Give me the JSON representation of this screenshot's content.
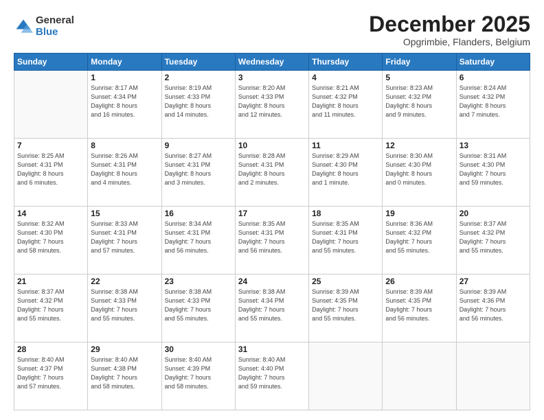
{
  "logo": {
    "general": "General",
    "blue": "Blue"
  },
  "title": "December 2025",
  "subtitle": "Opgrimbie, Flanders, Belgium",
  "days_header": [
    "Sunday",
    "Monday",
    "Tuesday",
    "Wednesday",
    "Thursday",
    "Friday",
    "Saturday"
  ],
  "weeks": [
    [
      {
        "num": "",
        "info": "",
        "empty": true
      },
      {
        "num": "1",
        "info": "Sunrise: 8:17 AM\nSunset: 4:34 PM\nDaylight: 8 hours\nand 16 minutes."
      },
      {
        "num": "2",
        "info": "Sunrise: 8:19 AM\nSunset: 4:33 PM\nDaylight: 8 hours\nand 14 minutes."
      },
      {
        "num": "3",
        "info": "Sunrise: 8:20 AM\nSunset: 4:33 PM\nDaylight: 8 hours\nand 12 minutes."
      },
      {
        "num": "4",
        "info": "Sunrise: 8:21 AM\nSunset: 4:32 PM\nDaylight: 8 hours\nand 11 minutes."
      },
      {
        "num": "5",
        "info": "Sunrise: 8:23 AM\nSunset: 4:32 PM\nDaylight: 8 hours\nand 9 minutes."
      },
      {
        "num": "6",
        "info": "Sunrise: 8:24 AM\nSunset: 4:32 PM\nDaylight: 8 hours\nand 7 minutes."
      }
    ],
    [
      {
        "num": "7",
        "info": "Sunrise: 8:25 AM\nSunset: 4:31 PM\nDaylight: 8 hours\nand 6 minutes."
      },
      {
        "num": "8",
        "info": "Sunrise: 8:26 AM\nSunset: 4:31 PM\nDaylight: 8 hours\nand 4 minutes."
      },
      {
        "num": "9",
        "info": "Sunrise: 8:27 AM\nSunset: 4:31 PM\nDaylight: 8 hours\nand 3 minutes."
      },
      {
        "num": "10",
        "info": "Sunrise: 8:28 AM\nSunset: 4:31 PM\nDaylight: 8 hours\nand 2 minutes."
      },
      {
        "num": "11",
        "info": "Sunrise: 8:29 AM\nSunset: 4:30 PM\nDaylight: 8 hours\nand 1 minute."
      },
      {
        "num": "12",
        "info": "Sunrise: 8:30 AM\nSunset: 4:30 PM\nDaylight: 8 hours\nand 0 minutes."
      },
      {
        "num": "13",
        "info": "Sunrise: 8:31 AM\nSunset: 4:30 PM\nDaylight: 7 hours\nand 59 minutes."
      }
    ],
    [
      {
        "num": "14",
        "info": "Sunrise: 8:32 AM\nSunset: 4:30 PM\nDaylight: 7 hours\nand 58 minutes."
      },
      {
        "num": "15",
        "info": "Sunrise: 8:33 AM\nSunset: 4:31 PM\nDaylight: 7 hours\nand 57 minutes."
      },
      {
        "num": "16",
        "info": "Sunrise: 8:34 AM\nSunset: 4:31 PM\nDaylight: 7 hours\nand 56 minutes."
      },
      {
        "num": "17",
        "info": "Sunrise: 8:35 AM\nSunset: 4:31 PM\nDaylight: 7 hours\nand 56 minutes."
      },
      {
        "num": "18",
        "info": "Sunrise: 8:35 AM\nSunset: 4:31 PM\nDaylight: 7 hours\nand 55 minutes."
      },
      {
        "num": "19",
        "info": "Sunrise: 8:36 AM\nSunset: 4:32 PM\nDaylight: 7 hours\nand 55 minutes."
      },
      {
        "num": "20",
        "info": "Sunrise: 8:37 AM\nSunset: 4:32 PM\nDaylight: 7 hours\nand 55 minutes."
      }
    ],
    [
      {
        "num": "21",
        "info": "Sunrise: 8:37 AM\nSunset: 4:32 PM\nDaylight: 7 hours\nand 55 minutes."
      },
      {
        "num": "22",
        "info": "Sunrise: 8:38 AM\nSunset: 4:33 PM\nDaylight: 7 hours\nand 55 minutes."
      },
      {
        "num": "23",
        "info": "Sunrise: 8:38 AM\nSunset: 4:33 PM\nDaylight: 7 hours\nand 55 minutes."
      },
      {
        "num": "24",
        "info": "Sunrise: 8:38 AM\nSunset: 4:34 PM\nDaylight: 7 hours\nand 55 minutes."
      },
      {
        "num": "25",
        "info": "Sunrise: 8:39 AM\nSunset: 4:35 PM\nDaylight: 7 hours\nand 55 minutes."
      },
      {
        "num": "26",
        "info": "Sunrise: 8:39 AM\nSunset: 4:35 PM\nDaylight: 7 hours\nand 56 minutes."
      },
      {
        "num": "27",
        "info": "Sunrise: 8:39 AM\nSunset: 4:36 PM\nDaylight: 7 hours\nand 56 minutes."
      }
    ],
    [
      {
        "num": "28",
        "info": "Sunrise: 8:40 AM\nSunset: 4:37 PM\nDaylight: 7 hours\nand 57 minutes."
      },
      {
        "num": "29",
        "info": "Sunrise: 8:40 AM\nSunset: 4:38 PM\nDaylight: 7 hours\nand 58 minutes."
      },
      {
        "num": "30",
        "info": "Sunrise: 8:40 AM\nSunset: 4:39 PM\nDaylight: 7 hours\nand 58 minutes."
      },
      {
        "num": "31",
        "info": "Sunrise: 8:40 AM\nSunset: 4:40 PM\nDaylight: 7 hours\nand 59 minutes."
      },
      {
        "num": "",
        "info": "",
        "empty": true
      },
      {
        "num": "",
        "info": "",
        "empty": true
      },
      {
        "num": "",
        "info": "",
        "empty": true
      }
    ]
  ]
}
